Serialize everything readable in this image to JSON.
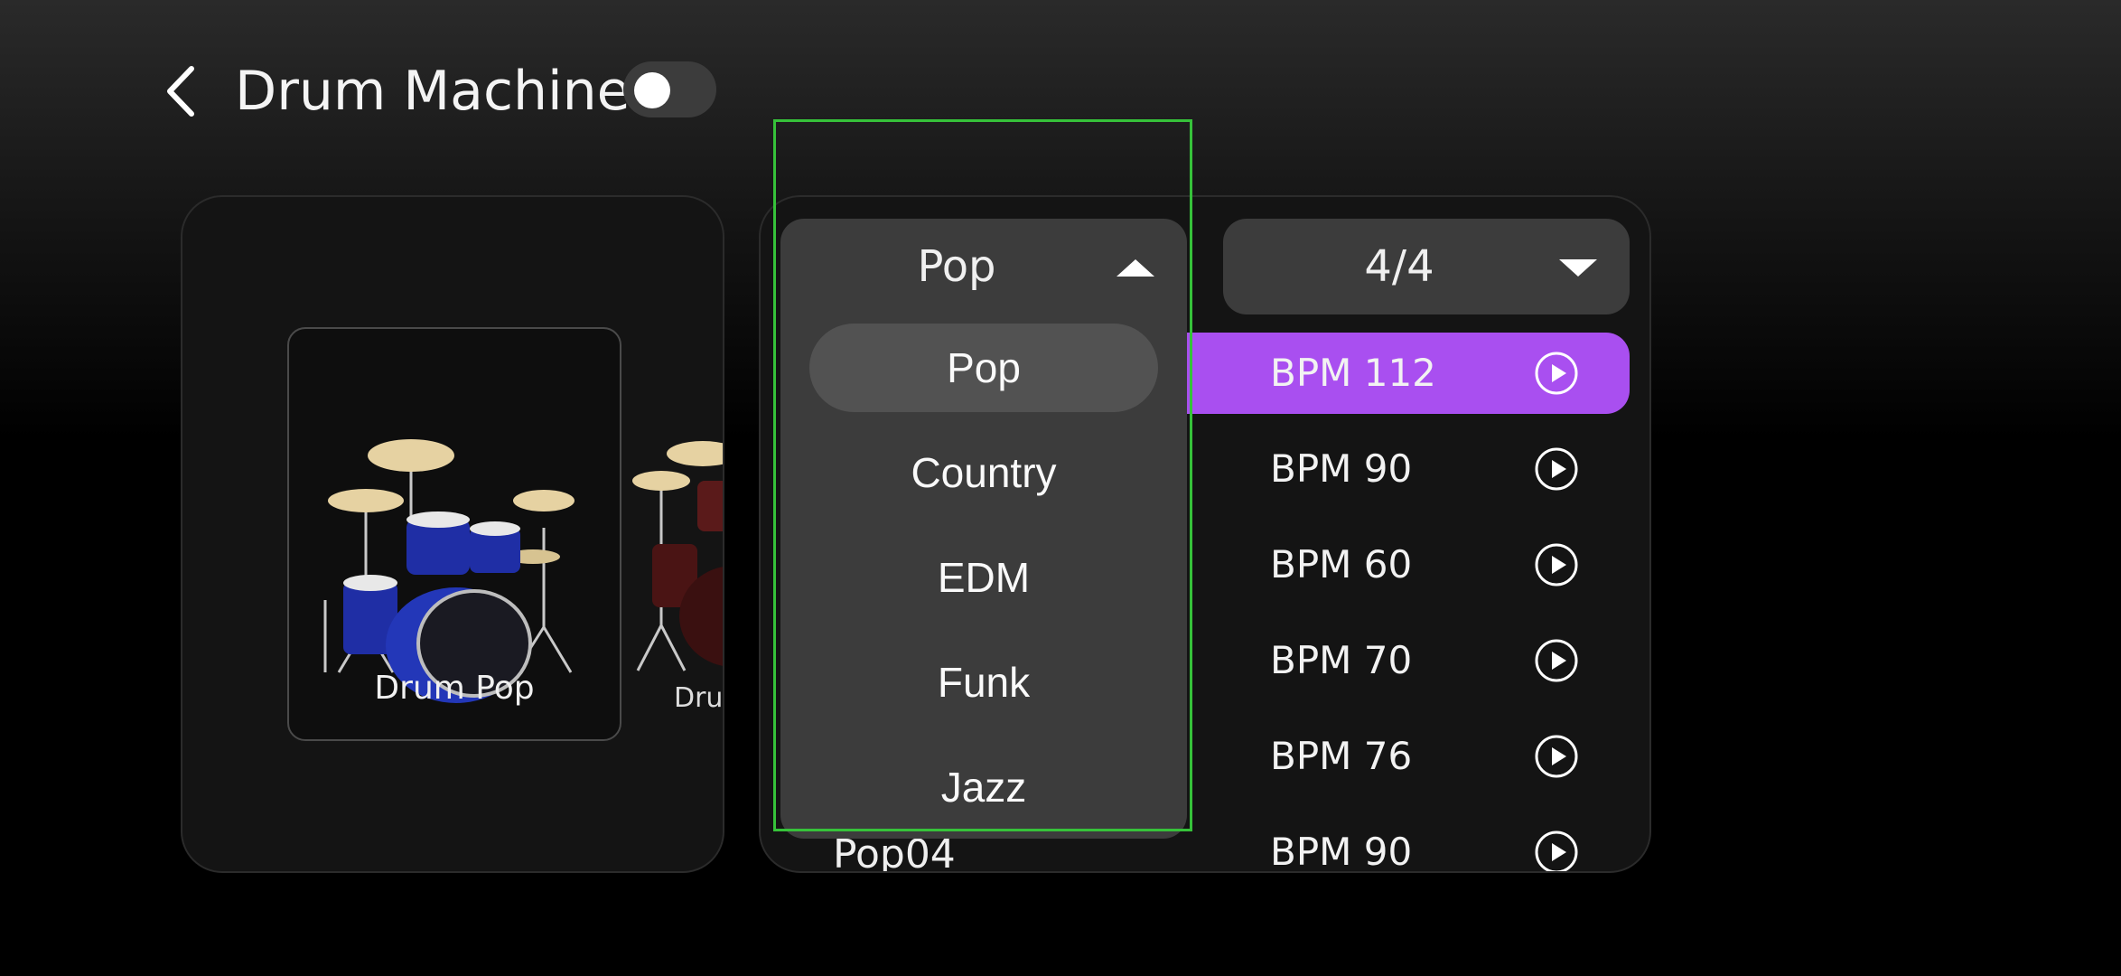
{
  "header": {
    "title": "Drum Machine",
    "toggle_on": false
  },
  "kits": [
    {
      "label": "Drum Pop",
      "selected": true
    },
    {
      "label": "Drum"
    }
  ],
  "time_signature": {
    "value": "4/4"
  },
  "genre_dropdown": {
    "value": "Pop",
    "options": [
      "Pop",
      "Country",
      "EDM",
      "Funk",
      "Jazz"
    ],
    "selected_index": 0
  },
  "patterns": [
    {
      "bpm": "BPM 112",
      "active": true
    },
    {
      "bpm": "BPM 90"
    },
    {
      "bpm": "BPM 60"
    },
    {
      "bpm": "BPM 70"
    },
    {
      "bpm": "BPM 76"
    },
    {
      "bpm": "BPM 90",
      "name": "Pop04"
    }
  ],
  "colors": {
    "accent": "#a94ff0",
    "highlight_box": "#36c23a"
  }
}
